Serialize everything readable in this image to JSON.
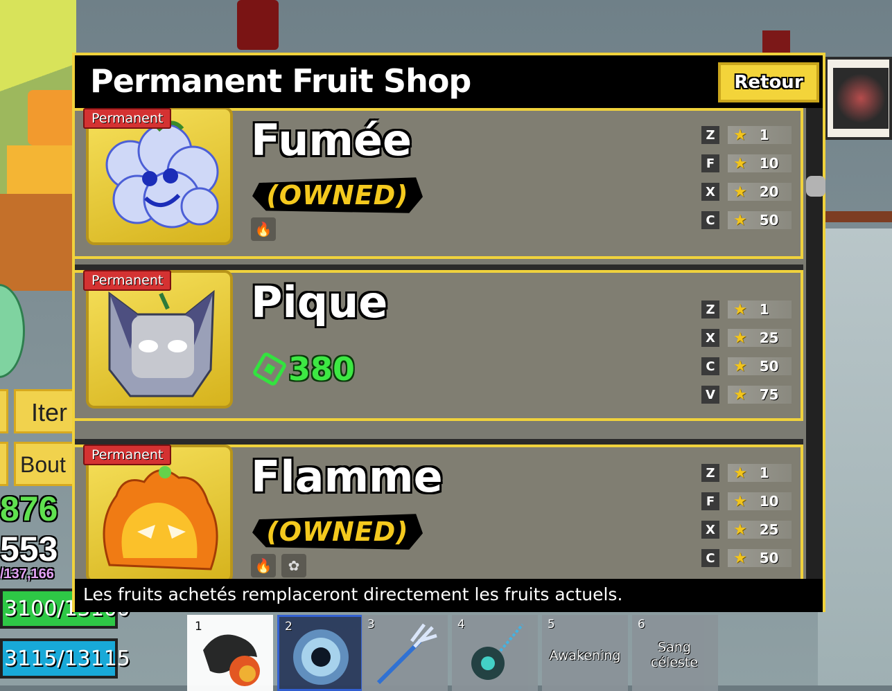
{
  "shop": {
    "title": "Permanent Fruit Shop",
    "back_label": "Retour",
    "footer_text": "Les fruits achetés remplaceront directement les fruits actuels.",
    "items": [
      {
        "badge": "Permanent",
        "name": "Fumée",
        "status": "(OWNED)",
        "moves": [
          {
            "key": "Z",
            "level": "1"
          },
          {
            "key": "F",
            "level": "10"
          },
          {
            "key": "X",
            "level": "20"
          },
          {
            "key": "C",
            "level": "50"
          }
        ]
      },
      {
        "badge": "Permanent",
        "name": "Pique",
        "price": "380",
        "moves": [
          {
            "key": "Z",
            "level": "1"
          },
          {
            "key": "X",
            "level": "25"
          },
          {
            "key": "C",
            "level": "50"
          },
          {
            "key": "V",
            "level": "75"
          }
        ]
      },
      {
        "badge": "Permanent",
        "name": "Flamme",
        "status": "(OWNED)",
        "moves": [
          {
            "key": "Z",
            "level": "1"
          },
          {
            "key": "F",
            "level": "10"
          },
          {
            "key": "X",
            "level": "25"
          },
          {
            "key": "C",
            "level": "50"
          }
        ]
      }
    ]
  },
  "hud": {
    "item_btn": "Iter",
    "shop_btn": "Bout",
    "beli": "876",
    "fragments": "553",
    "xp": "/137,166",
    "health": "3100/13100",
    "energy": "3115/13115"
  },
  "hotbar": {
    "slots": [
      {
        "num": "1",
        "label": ""
      },
      {
        "num": "2",
        "label": ""
      },
      {
        "num": "3",
        "label": ""
      },
      {
        "num": "4",
        "label": ""
      },
      {
        "num": "5",
        "label": "Awakening"
      },
      {
        "num": "6",
        "label": "Sang céleste"
      }
    ]
  },
  "colors": {
    "frame_yellow": "#f0d23c",
    "badge_red": "#d43232",
    "price_green": "#3de843",
    "owned_gold": "#f4c91e"
  }
}
